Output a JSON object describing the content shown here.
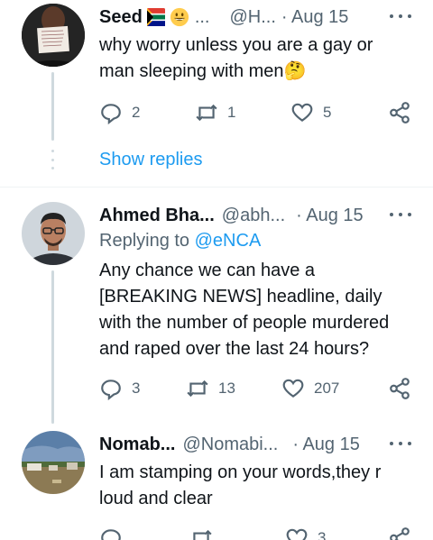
{
  "tweets": [
    {
      "name": "Seed",
      "handle": "@H...",
      "date": "· Aug 15",
      "text": "why worry unless you are a gay or man sleeping with men",
      "emoji_trail": "🤔",
      "replies": "2",
      "retweets": "1",
      "likes": "5"
    },
    {
      "name": "Ahmed Bha...",
      "handle": "@abh...",
      "date": "· Aug 15",
      "replying_label": "Replying to",
      "replying_to": "@eNCA",
      "text": "Any chance we can have a [BREAKING NEWS] headline, daily with the number of people murdered and raped over the last 24 hours?",
      "replies": "3",
      "retweets": "13",
      "likes": "207"
    },
    {
      "name": "Nomab...",
      "handle": "@Nomabi...",
      "date": "· Aug 15",
      "text": "I am stamping on your words,they r loud and clear",
      "replies": "",
      "retweets": "",
      "likes": "3"
    }
  ],
  "show_replies": "Show replies",
  "colors": {
    "accent": "#1d9bf0",
    "muted": "#536471",
    "text": "#0f1419",
    "line": "#cfd9de"
  }
}
